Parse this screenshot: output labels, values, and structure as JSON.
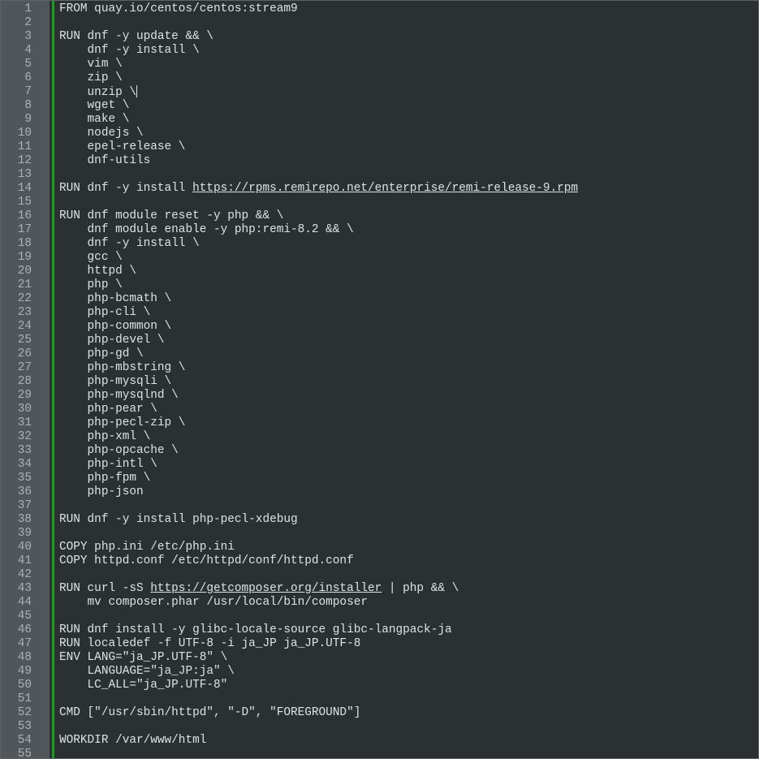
{
  "editor": {
    "language": "Dockerfile",
    "caret_line": 7,
    "colors": {
      "background": "#2b3133",
      "gutter": "#50575a",
      "change_bar": "#1f9a1f",
      "text": "#dfe2e3",
      "line_numbers": "#aab2b5"
    },
    "lines": [
      "FROM quay.io/centos/centos:stream9",
      "",
      "RUN dnf -y update && \\",
      "    dnf -y install \\",
      "    vim \\",
      "    zip \\",
      "    unzip \\",
      "    wget \\",
      "    make \\",
      "    nodejs \\",
      "    epel-release \\",
      "    dnf-utils",
      "",
      "RUN dnf -y install https://rpms.remirepo.net/enterprise/remi-release-9.rpm",
      "",
      "RUN dnf module reset -y php && \\",
      "    dnf module enable -y php:remi-8.2 && \\",
      "    dnf -y install \\",
      "    gcc \\",
      "    httpd \\",
      "    php \\",
      "    php-bcmath \\",
      "    php-cli \\",
      "    php-common \\",
      "    php-devel \\",
      "    php-gd \\",
      "    php-mbstring \\",
      "    php-mysqli \\",
      "    php-mysqlnd \\",
      "    php-pear \\",
      "    php-pecl-zip \\",
      "    php-xml \\",
      "    php-opcache \\",
      "    php-intl \\",
      "    php-fpm \\",
      "    php-json",
      "",
      "RUN dnf -y install php-pecl-xdebug",
      "",
      "COPY php.ini /etc/php.ini",
      "COPY httpd.conf /etc/httpd/conf/httpd.conf",
      "",
      "RUN curl -sS https://getcomposer.org/installer | php && \\",
      "    mv composer.phar /usr/local/bin/composer",
      "",
      "RUN dnf install -y glibc-locale-source glibc-langpack-ja",
      "RUN localedef -f UTF-8 -i ja_JP ja_JP.UTF-8",
      "ENV LANG=\"ja_JP.UTF-8\" \\",
      "    LANGUAGE=\"ja_JP:ja\" \\",
      "    LC_ALL=\"ja_JP.UTF-8\"",
      "",
      "CMD [\"/usr/sbin/httpd\", \"-D\", \"FOREGROUND\"]",
      "",
      "WORKDIR /var/www/html",
      ""
    ]
  }
}
